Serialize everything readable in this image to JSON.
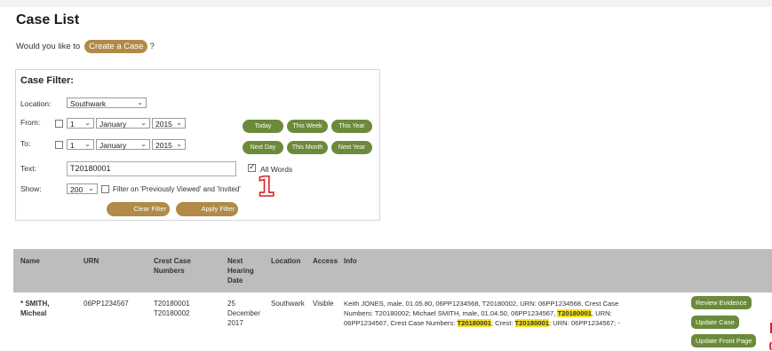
{
  "page": {
    "title": "Case List",
    "prompt_prefix": "Would you like to",
    "create_case": "Create a Case",
    "prompt_suffix": "?"
  },
  "filter": {
    "title": "Case Filter:",
    "location_label": "Location:",
    "location_value": "Southwark",
    "from_label": "From:",
    "from_day": "1",
    "from_month": "January",
    "from_year": "2015",
    "to_label": "To:",
    "to_day": "1",
    "to_month": "January",
    "to_year": "2015",
    "text_label": "Text:",
    "text_value": "T20180001",
    "all_words": "All Words",
    "show_label": "Show:",
    "show_value": "200",
    "filter_note": "Filter on 'Previously Viewed' and 'Invited'",
    "clear": "Clear Filter",
    "apply": "Apply Filter",
    "quick": [
      "Today",
      "This Week",
      "This Year",
      "Next Day",
      "This Month",
      "Next Year"
    ]
  },
  "annotation": "1",
  "table": {
    "headers": {
      "name": "Name",
      "urn": "URN",
      "crest1": "Crest Case",
      "crest2": "Numbers",
      "hearing1": "Next",
      "hearing2": "Hearing",
      "hearing3": "Date",
      "location": "Location",
      "access": "Access",
      "info": "Info"
    },
    "row": {
      "name1": "* SMITH,",
      "name2": "Micheal",
      "urn": "06PP1234567",
      "crest1": "T20180001",
      "crest2": "T20180002",
      "date1": "25",
      "date2": "December",
      "date3": "2017",
      "location": "Southwark",
      "access": "Visible",
      "info_l1": "Keith JONES, male, 01.05.80, 06PP1234568, T20180002, URN: 06PP1234568, Crest Case",
      "info_l2a": "Numbers: T20180002; Michael SMITH, male, 01.04.50, 06PP1234567,",
      "info_l2b": "T20180001",
      "info_l2c": ", URN:",
      "info_l3a": "06PP1234567, Crest Case Numbers:",
      "info_l3b": "T20180001",
      "info_l3c": "; Crest:",
      "info_l3d": "T20180001",
      "info_l3e": "; URN: 06PP1234567; -",
      "actions": [
        "Review Evidence",
        "Update Case",
        "Update Front Page"
      ]
    }
  },
  "colors": {
    "gold": "#b08a46",
    "green": "#6b8a3a",
    "header": "#bdbdbd",
    "highlight": "#f5e21b",
    "annotation": "#d8232a"
  }
}
